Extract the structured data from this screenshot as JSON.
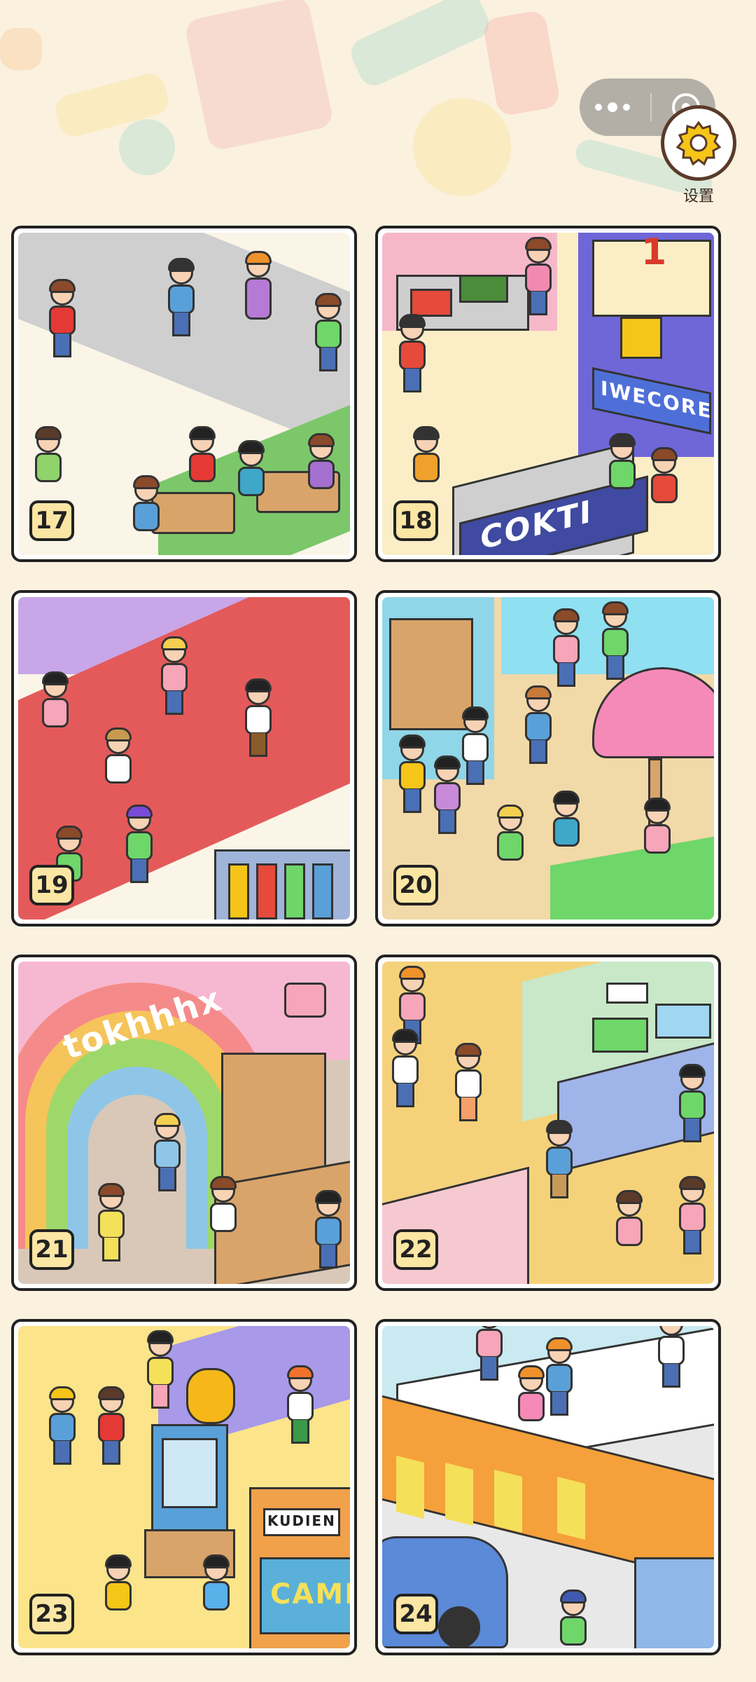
{
  "header": {
    "settings_label": "设置",
    "settings_icon": "gear-icon",
    "more_icon": "more-dots-icon",
    "close_icon": "close-target-icon"
  },
  "levels": [
    {
      "number": "17",
      "sign": ""
    },
    {
      "number": "18",
      "sign": "COKTI"
    },
    {
      "number": "19",
      "sign": ""
    },
    {
      "number": "20",
      "sign": ""
    },
    {
      "number": "21",
      "sign": "tokhhhx"
    },
    {
      "number": "22",
      "sign": ""
    },
    {
      "number": "23",
      "sign": "KUDIEN"
    },
    {
      "number": "24",
      "sign": ""
    }
  ],
  "level18_extra_sign": "IWECORE",
  "level18_digit": "1",
  "level23_screen_text": "CAMB",
  "colors": {
    "background": "#fbf1df",
    "badge": "#fce6a4",
    "card_border": "#222222",
    "gear_yellow": "#f5c518"
  }
}
